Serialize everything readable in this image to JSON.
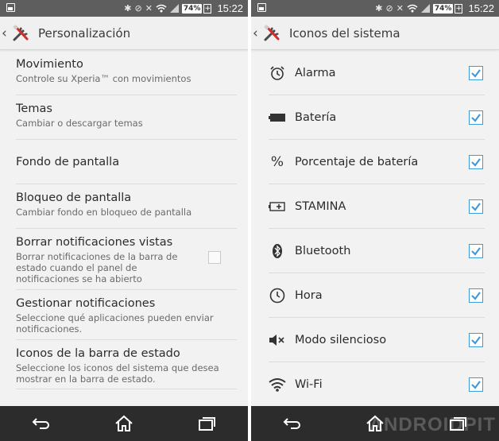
{
  "status": {
    "battery": "74%",
    "charging": "+",
    "time": "15:22"
  },
  "left": {
    "title": "Personalización",
    "items": [
      {
        "title": "Movimiento",
        "subtitle": "Controle su Xperia™ con movimientos"
      },
      {
        "title": "Temas",
        "subtitle": "Cambiar o descargar temas"
      },
      {
        "title": "Fondo de pantalla",
        "subtitle": ""
      },
      {
        "title": "Bloqueo de pantalla",
        "subtitle": "Cambiar fondo en bloqueo de pantalla"
      },
      {
        "title": "Borrar notificaciones vistas",
        "subtitle_lines": [
          "Borrar notificaciones de la barra de",
          "estado cuando el panel de",
          "notificaciones se ha abierto"
        ]
      },
      {
        "title": "Gestionar notificaciones",
        "subtitle_lines": [
          "Seleccione qué aplicaciones pueden enviar",
          "notificaciones."
        ]
      },
      {
        "title": "Iconos de la barra de estado",
        "subtitle_lines": [
          "Seleccione los iconos del sistema que desea",
          "mostrar en la barra de estado."
        ]
      }
    ]
  },
  "right": {
    "title": "Iconos del sistema",
    "items": [
      {
        "label": "Alarma",
        "icon": "alarm-clock-icon",
        "checked": true
      },
      {
        "label": "Batería",
        "icon": "battery-icon",
        "checked": true
      },
      {
        "label": "Porcentaje de batería",
        "icon": "percent-icon",
        "checked": true
      },
      {
        "label": "STAMINA",
        "icon": "stamina-battery-icon",
        "checked": true
      },
      {
        "label": "Bluetooth",
        "icon": "bluetooth-icon",
        "checked": true
      },
      {
        "label": "Hora",
        "icon": "clock-icon",
        "checked": true
      },
      {
        "label": "Modo silencioso",
        "icon": "speaker-muted-icon",
        "checked": true
      },
      {
        "label": "Wi-Fi",
        "icon": "wifi-icon",
        "checked": true
      }
    ]
  },
  "watermark": "ANDROIDPIT",
  "colors": {
    "accent": "#3d9bd7",
    "statusbar": "#5e5e5e",
    "navbar": "#2c2c2c"
  }
}
